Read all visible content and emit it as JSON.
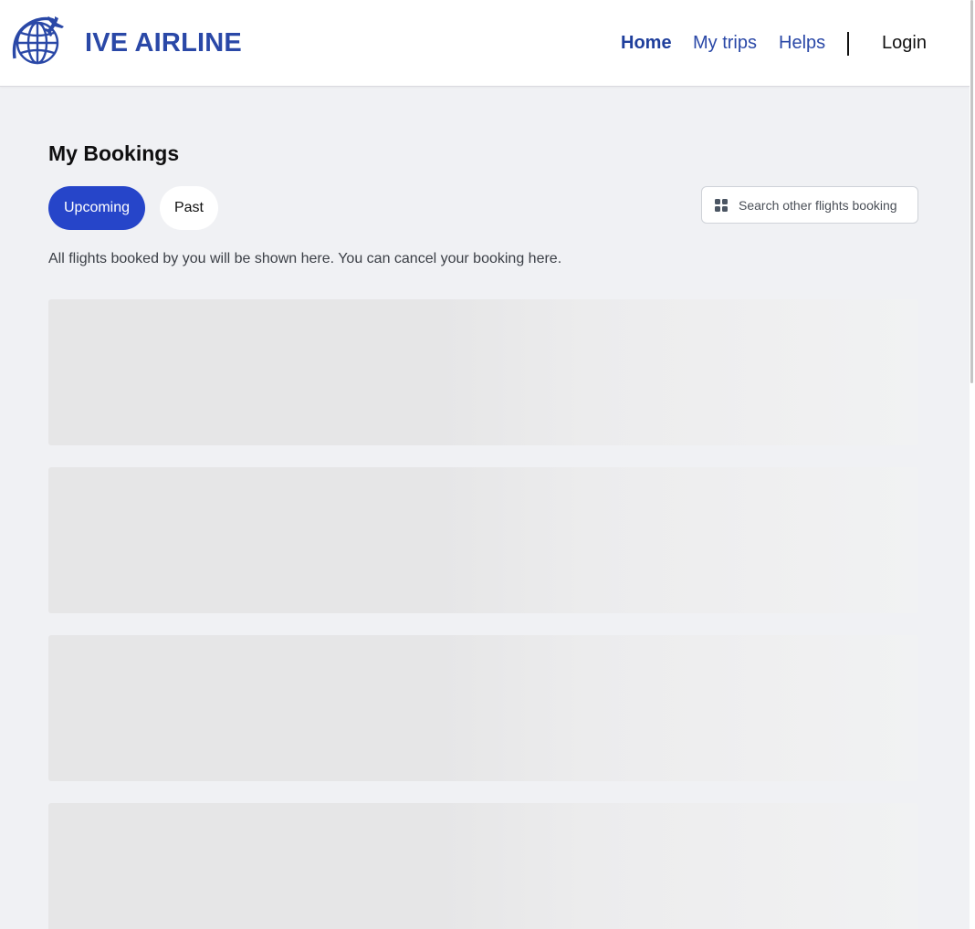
{
  "header": {
    "brand": "IVE AIRLINE",
    "nav": {
      "home": "Home",
      "my_trips": "My trips",
      "helps": "Helps",
      "login": "Login"
    }
  },
  "main": {
    "title": "My Bookings",
    "tabs": {
      "upcoming": "Upcoming",
      "past": "Past",
      "active": "Upcoming"
    },
    "search_button": {
      "label": "Search other flights booking",
      "icon": "grid-icon"
    },
    "description": "All flights booked by you will be shown here. You can cancel your booking here.",
    "loading_placeholders": 4
  },
  "colors": {
    "brand": "#2a48a7",
    "accent": "#2645c9",
    "background": "#f0f1f4",
    "skeleton": "#e6e6e7"
  }
}
